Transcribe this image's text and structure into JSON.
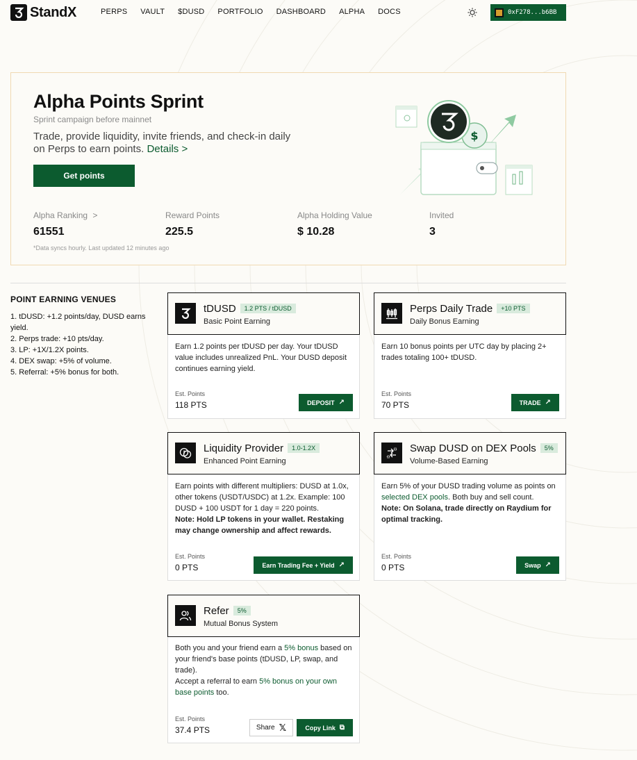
{
  "nav": {
    "brand": "StandX",
    "links": [
      "PERPS",
      "VAULT",
      "$DUSD",
      "PORTFOLIO",
      "DASHBOARD",
      "ALPHA",
      "DOCS"
    ],
    "wallet_address": "0xF278...b6BB",
    "theme_icon": "sun-icon"
  },
  "hero": {
    "title": "Alpha Points Sprint",
    "subtitle": "Sprint campaign before mainnet",
    "description": "Trade, provide liquidity, invite friends, and check-in daily on Perps to earn points.",
    "details_link": "Details >",
    "cta": "Get points",
    "stats": [
      {
        "label": "Alpha Ranking",
        "suffix": ">",
        "value": "61551"
      },
      {
        "label": "Reward Points",
        "value": "225.5"
      },
      {
        "label": "Alpha Holding Value",
        "value": "$ 10.28"
      },
      {
        "label": "Invited",
        "value": "3"
      }
    ],
    "sync_note": "*Data syncs hourly. Last updated 12 minutes ago"
  },
  "venues": {
    "title": "POINT EARNING VENUES",
    "items": [
      "1. tDUSD: +1.2 points/day, DUSD earns yield.",
      "2. Perps trade: +10 pts/day.",
      "3. LP: +1X/1.2X points.",
      "4. DEX swap: +5% of volume.",
      "5. Referral: +5% bonus for both."
    ]
  },
  "cards": {
    "tdusd": {
      "title": "tDUSD",
      "badge": "1.2 PTS / tDUSD",
      "subtitle": "Basic Point Earning",
      "body": "Earn 1.2 points per tDUSD per day. Your tDUSD value includes unrealized PnL. Your DUSD deposit continues earning yield.",
      "est_label": "Est. Points",
      "est_value": "118 PTS",
      "button": "DEPOSIT",
      "icon": "standx-logo-icon"
    },
    "perps": {
      "title": "Perps Daily Trade",
      "badge": "+10 PTS",
      "subtitle": "Daily Bonus Earning",
      "body": "Earn 10 bonus points per UTC day by placing 2+ trades totaling 100+ tDUSD.",
      "est_label": "Est. Points",
      "est_value": "70 PTS",
      "button": "TRADE",
      "icon": "candlestick-icon"
    },
    "lp": {
      "title": "Liquidity Provider",
      "badge": "1.0-1.2X",
      "subtitle": "Enhanced Point Earning",
      "body": "Earn points with different multipliers: DUSD at 1.0x, other tokens (USDT/USDC) at 1.2x. Example: 100 DUSD + 100 USDT for 1 day = 220 points.",
      "note": "Note: Hold LP tokens in your wallet. Restaking may change ownership and affect rewards.",
      "est_label": "Est. Points",
      "est_value": "0 PTS",
      "button": "Earn Trading Fee + Yield",
      "icon": "coins-icon"
    },
    "swap": {
      "title": "Swap DUSD on DEX Pools",
      "badge": "5%",
      "subtitle": "Volume-Based Earning",
      "body_pre": "Earn 5% of your DUSD trading volume as points on",
      "body_link": "selected DEX pools",
      "body_post": ". Both buy and sell count.",
      "note": "Note: On Solana, trade directly on Raydium for optimal tracking.",
      "est_label": "Est. Points",
      "est_value": "0 PTS",
      "button": "Swap",
      "icon": "swap-icon"
    },
    "refer": {
      "title": "Refer",
      "badge": "5%",
      "subtitle": "Mutual Bonus System",
      "body_a": "Both you and your friend earn a",
      "body_link1": "5% bonus",
      "body_b": "based on your friend's base points (tDUSD, LP, swap, and trade).",
      "body_c": "Accept a referral to earn",
      "body_link2": "5% bonus on your own base points",
      "body_d": "too.",
      "est_label": "Est. Points",
      "est_value": "37.4 PTS",
      "share_button": "Share",
      "copy_button": "Copy Link",
      "icon": "users-icon"
    }
  }
}
